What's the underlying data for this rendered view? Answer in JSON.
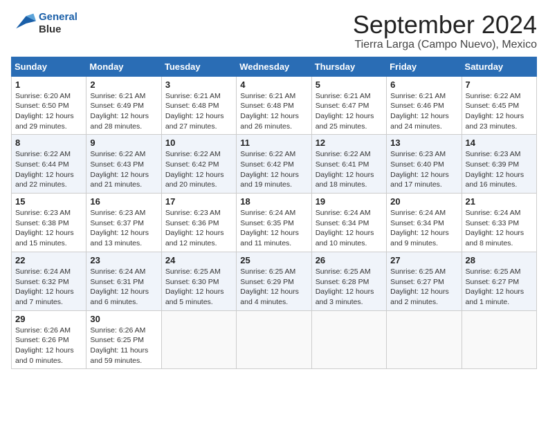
{
  "logo": {
    "line1": "General",
    "line2": "Blue"
  },
  "title": "September 2024",
  "subtitle": "Tierra Larga (Campo Nuevo), Mexico",
  "headers": [
    "Sunday",
    "Monday",
    "Tuesday",
    "Wednesday",
    "Thursday",
    "Friday",
    "Saturday"
  ],
  "weeks": [
    [
      {
        "day": "1",
        "info": "Sunrise: 6:20 AM\nSunset: 6:50 PM\nDaylight: 12 hours\nand 29 minutes."
      },
      {
        "day": "2",
        "info": "Sunrise: 6:21 AM\nSunset: 6:49 PM\nDaylight: 12 hours\nand 28 minutes."
      },
      {
        "day": "3",
        "info": "Sunrise: 6:21 AM\nSunset: 6:48 PM\nDaylight: 12 hours\nand 27 minutes."
      },
      {
        "day": "4",
        "info": "Sunrise: 6:21 AM\nSunset: 6:48 PM\nDaylight: 12 hours\nand 26 minutes."
      },
      {
        "day": "5",
        "info": "Sunrise: 6:21 AM\nSunset: 6:47 PM\nDaylight: 12 hours\nand 25 minutes."
      },
      {
        "day": "6",
        "info": "Sunrise: 6:21 AM\nSunset: 6:46 PM\nDaylight: 12 hours\nand 24 minutes."
      },
      {
        "day": "7",
        "info": "Sunrise: 6:22 AM\nSunset: 6:45 PM\nDaylight: 12 hours\nand 23 minutes."
      }
    ],
    [
      {
        "day": "8",
        "info": "Sunrise: 6:22 AM\nSunset: 6:44 PM\nDaylight: 12 hours\nand 22 minutes."
      },
      {
        "day": "9",
        "info": "Sunrise: 6:22 AM\nSunset: 6:43 PM\nDaylight: 12 hours\nand 21 minutes."
      },
      {
        "day": "10",
        "info": "Sunrise: 6:22 AM\nSunset: 6:42 PM\nDaylight: 12 hours\nand 20 minutes."
      },
      {
        "day": "11",
        "info": "Sunrise: 6:22 AM\nSunset: 6:42 PM\nDaylight: 12 hours\nand 19 minutes."
      },
      {
        "day": "12",
        "info": "Sunrise: 6:22 AM\nSunset: 6:41 PM\nDaylight: 12 hours\nand 18 minutes."
      },
      {
        "day": "13",
        "info": "Sunrise: 6:23 AM\nSunset: 6:40 PM\nDaylight: 12 hours\nand 17 minutes."
      },
      {
        "day": "14",
        "info": "Sunrise: 6:23 AM\nSunset: 6:39 PM\nDaylight: 12 hours\nand 16 minutes."
      }
    ],
    [
      {
        "day": "15",
        "info": "Sunrise: 6:23 AM\nSunset: 6:38 PM\nDaylight: 12 hours\nand 15 minutes."
      },
      {
        "day": "16",
        "info": "Sunrise: 6:23 AM\nSunset: 6:37 PM\nDaylight: 12 hours\nand 13 minutes."
      },
      {
        "day": "17",
        "info": "Sunrise: 6:23 AM\nSunset: 6:36 PM\nDaylight: 12 hours\nand 12 minutes."
      },
      {
        "day": "18",
        "info": "Sunrise: 6:24 AM\nSunset: 6:35 PM\nDaylight: 12 hours\nand 11 minutes."
      },
      {
        "day": "19",
        "info": "Sunrise: 6:24 AM\nSunset: 6:34 PM\nDaylight: 12 hours\nand 10 minutes."
      },
      {
        "day": "20",
        "info": "Sunrise: 6:24 AM\nSunset: 6:34 PM\nDaylight: 12 hours\nand 9 minutes."
      },
      {
        "day": "21",
        "info": "Sunrise: 6:24 AM\nSunset: 6:33 PM\nDaylight: 12 hours\nand 8 minutes."
      }
    ],
    [
      {
        "day": "22",
        "info": "Sunrise: 6:24 AM\nSunset: 6:32 PM\nDaylight: 12 hours\nand 7 minutes."
      },
      {
        "day": "23",
        "info": "Sunrise: 6:24 AM\nSunset: 6:31 PM\nDaylight: 12 hours\nand 6 minutes."
      },
      {
        "day": "24",
        "info": "Sunrise: 6:25 AM\nSunset: 6:30 PM\nDaylight: 12 hours\nand 5 minutes."
      },
      {
        "day": "25",
        "info": "Sunrise: 6:25 AM\nSunset: 6:29 PM\nDaylight: 12 hours\nand 4 minutes."
      },
      {
        "day": "26",
        "info": "Sunrise: 6:25 AM\nSunset: 6:28 PM\nDaylight: 12 hours\nand 3 minutes."
      },
      {
        "day": "27",
        "info": "Sunrise: 6:25 AM\nSunset: 6:27 PM\nDaylight: 12 hours\nand 2 minutes."
      },
      {
        "day": "28",
        "info": "Sunrise: 6:25 AM\nSunset: 6:27 PM\nDaylight: 12 hours\nand 1 minute."
      }
    ],
    [
      {
        "day": "29",
        "info": "Sunrise: 6:26 AM\nSunset: 6:26 PM\nDaylight: 12 hours\nand 0 minutes."
      },
      {
        "day": "30",
        "info": "Sunrise: 6:26 AM\nSunset: 6:25 PM\nDaylight: 11 hours\nand 59 minutes."
      },
      null,
      null,
      null,
      null,
      null
    ]
  ]
}
